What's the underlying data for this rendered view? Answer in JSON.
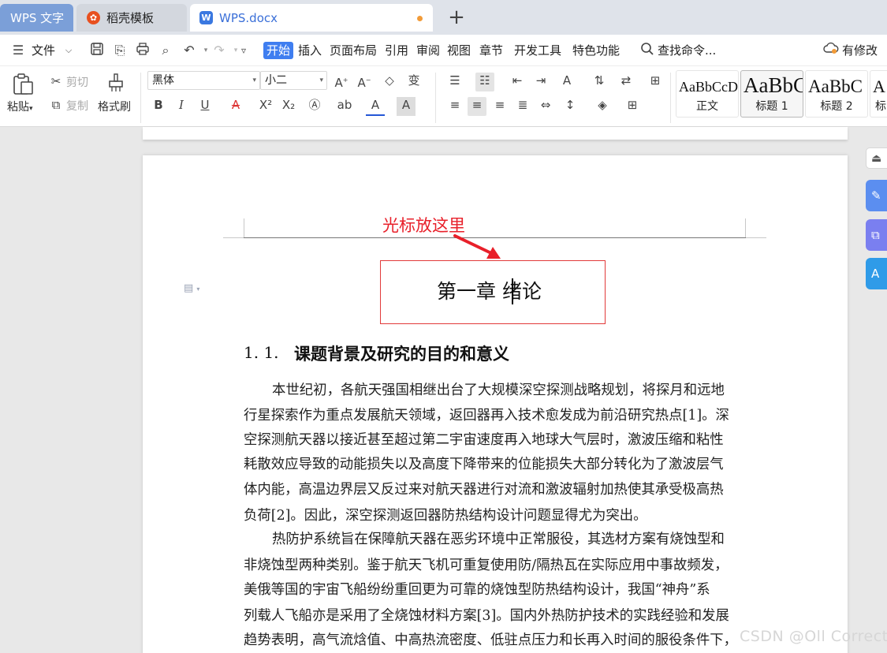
{
  "tabs": [
    {
      "label": "WPS 文字"
    },
    {
      "label": "稻壳模板",
      "icon": "daoke-logo-icon"
    },
    {
      "label": "WPS.docx",
      "icon": "wps-writer-icon",
      "unsaved": true
    }
  ],
  "new_tab": "+",
  "menu": {
    "file": "文件",
    "items": [
      "开始",
      "插入",
      "页面布局",
      "引用",
      "审阅",
      "视图",
      "章节",
      "开发工具",
      "特色功能"
    ],
    "active": "开始",
    "search": "查找命令...",
    "cloud_status": "有修改"
  },
  "ribbon": {
    "paste": "粘贴",
    "cut": "剪切",
    "copy": "复制",
    "format_painter": "格式刷",
    "font_name": "黑体",
    "font_size": "小二",
    "styles": [
      {
        "preview": "AaBbCcDd",
        "name": "正文"
      },
      {
        "preview": "AaBbC",
        "name": "标题 1",
        "selected": true
      },
      {
        "preview": "AaBbC",
        "name": "标题 2"
      },
      {
        "preview": "A",
        "name": "标"
      }
    ]
  },
  "annotation": {
    "text": "光标放这里",
    "color": "#e8202a"
  },
  "document": {
    "chapter_title": "第一章  绪论",
    "section_number": "1. 1.",
    "section_title": "课题背景及研究的目的和意义",
    "body_lines": [
      "本世纪初，各航天强国相继出台了大规模深空探测战略规划，将探月和远地",
      "行星探索作为重点发展航天领域，返回器再入技术愈发成为前沿研究热点[1]。深",
      "空探测航天器以接近甚至超过第二宇宙速度再入地球大气层时，激波压缩和粘性",
      "耗散效应导致的动能损失以及高度下降带来的位能损失大部分转化为了激波层气",
      "体内能，高温边界层又反过来对航天器进行对流和激波辐射加热使其承受极高热",
      "负荷[2]。因此，深空探测返回器防热结构设计问题显得尤为突出。",
      "热防护系统旨在保障航天器在恶劣环境中正常服役，其选材方案有烧蚀型和",
      "非烧蚀型两种类别。鉴于航天飞机可重复使用防/隔热瓦在实际应用中事故频发，",
      "美俄等国的宇宙飞船纷纷重回更为可靠的烧蚀型防热结构设计，我国“神舟”系",
      "列载人飞船亦是采用了全烧蚀材料方案[3]。国内外热防护技术的实践经验和发展",
      "趋势表明，高气流焓值、中高热流密度、低驻点压力和长再入时间的服役条件下，"
    ]
  },
  "watermark": "CSDN @Oll Correct",
  "colors": {
    "accent": "#3f7ef0",
    "highlight_border": "#e23a3a",
    "rail_blue": "#5b8ef0",
    "rail_purple": "#7a7ff0"
  }
}
